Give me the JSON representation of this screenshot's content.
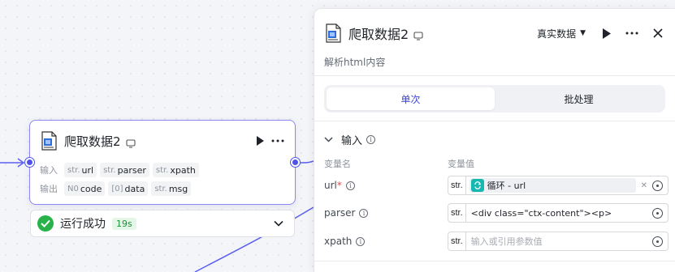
{
  "node": {
    "title": "爬取数据2",
    "input_label": "输入",
    "output_label": "输出",
    "inputs": [
      {
        "type": "str.",
        "name": "url"
      },
      {
        "type": "str.",
        "name": "parser"
      },
      {
        "type": "str.",
        "name": "xpath"
      }
    ],
    "outputs": [
      {
        "type": "N0",
        "name": "code"
      },
      {
        "type": "[0]",
        "name": "data"
      },
      {
        "type": "str.",
        "name": "msg"
      }
    ]
  },
  "status": {
    "text": "运行成功",
    "time": "19s"
  },
  "panel": {
    "title": "爬取数据2",
    "mode": "真实数据",
    "description": "解析html内容",
    "tabs": [
      {
        "label": "单次"
      },
      {
        "label": "批处理"
      }
    ],
    "section_title": "输入",
    "col_name": "变量名",
    "col_value": "变量值",
    "params": [
      {
        "name": "url",
        "required": "*",
        "type": "str.",
        "ref_text": "循环 - url"
      },
      {
        "name": "parser",
        "type": "str.",
        "value": "<div class=\"ctx-content\"><p>"
      },
      {
        "name": "xpath",
        "type": "str.",
        "placeholder": "输入或引用参数值"
      }
    ]
  },
  "colors": {
    "accent": "#4e54e8",
    "success": "#2ab24a",
    "loop": "#16b8b0"
  }
}
